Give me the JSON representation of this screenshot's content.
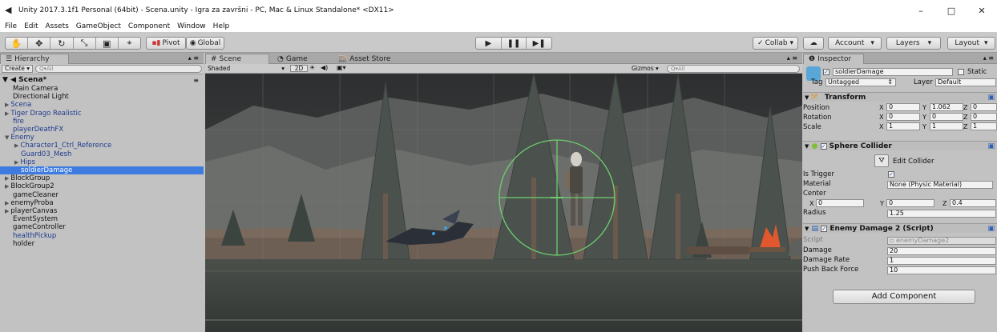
{
  "window": {
    "title": "Unity 2017.3.1f1 Personal (64bit) - Scena.unity - Igra za završni - PC, Mac & Linux Standalone* <DX11>",
    "controls": [
      "–",
      "□",
      "✕"
    ]
  },
  "menu": [
    "File",
    "Edit",
    "Assets",
    "GameObject",
    "Component",
    "Window",
    "Help"
  ],
  "toolbar": {
    "tool_icons": [
      "hand-icon",
      "move-icon",
      "rotate-icon",
      "scale-icon",
      "rect-icon",
      "transform-icon"
    ],
    "pivot": "Pivot",
    "global": "Global",
    "collab": "Collab ▾",
    "account": "Account",
    "layers": "Layers",
    "layout": "Layout"
  },
  "hierarchy": {
    "tab": "Hierarchy",
    "create": "Create ▾",
    "search_placeholder": "Q▾All",
    "scene": "Scena*",
    "items": [
      {
        "label": "Main Camera",
        "indent": 1,
        "blue": false,
        "arrow": false,
        "sel": false
      },
      {
        "label": "Directional Light",
        "indent": 1,
        "blue": false,
        "arrow": false,
        "sel": false
      },
      {
        "label": "Scena",
        "indent": 1,
        "blue": true,
        "arrow": true,
        "sel": false
      },
      {
        "label": "Tiger Drago Realistic",
        "indent": 1,
        "blue": true,
        "arrow": true,
        "sel": false
      },
      {
        "label": "fire",
        "indent": 1,
        "blue": true,
        "arrow": false,
        "sel": false
      },
      {
        "label": "playerDeathFX",
        "indent": 1,
        "blue": true,
        "arrow": false,
        "sel": false
      },
      {
        "label": "Enemy",
        "indent": 1,
        "blue": true,
        "arrow": true,
        "open": true,
        "sel": false
      },
      {
        "label": "Character1_Ctrl_Reference",
        "indent": 2,
        "blue": true,
        "arrow": true,
        "sel": false
      },
      {
        "label": "Guard03_Mesh",
        "indent": 2,
        "blue": true,
        "arrow": false,
        "sel": false
      },
      {
        "label": "Hips",
        "indent": 2,
        "blue": true,
        "arrow": true,
        "sel": false
      },
      {
        "label": "soldierDamage",
        "indent": 2,
        "blue": false,
        "arrow": false,
        "sel": true
      },
      {
        "label": "BlockGroup",
        "indent": 1,
        "blue": false,
        "arrow": true,
        "sel": false
      },
      {
        "label": "BlockGroup2",
        "indent": 1,
        "blue": false,
        "arrow": true,
        "sel": false
      },
      {
        "label": "gameCleaner",
        "indent": 1,
        "blue": false,
        "arrow": false,
        "sel": false
      },
      {
        "label": "enemyProba",
        "indent": 1,
        "blue": false,
        "arrow": true,
        "sel": false
      },
      {
        "label": "playerCanvas",
        "indent": 1,
        "blue": false,
        "arrow": true,
        "sel": false
      },
      {
        "label": "EventSystem",
        "indent": 1,
        "blue": false,
        "arrow": false,
        "sel": false
      },
      {
        "label": "gameController",
        "indent": 1,
        "blue": false,
        "arrow": false,
        "sel": false
      },
      {
        "label": "healthPickup",
        "indent": 1,
        "blue": true,
        "arrow": false,
        "sel": false
      },
      {
        "label": "holder",
        "indent": 1,
        "blue": false,
        "arrow": false,
        "sel": false
      }
    ]
  },
  "scene_view": {
    "tabs": [
      "Scene",
      "Game",
      "Asset Store"
    ],
    "shading": "Shaded",
    "mode_2d": "2D",
    "gizmos": "Gizmos ▾",
    "search_placeholder": "Q▾All"
  },
  "inspector": {
    "tab": "Inspector",
    "object_name": "soldierDamage",
    "static_label": "Static",
    "tag_label": "Tag",
    "tag_value": "Untagged",
    "layer_label": "Layer",
    "layer_value": "Default",
    "transform": {
      "title": "Transform",
      "rows": [
        {
          "label": "Position",
          "x": "0",
          "y": "1.062",
          "z": "0"
        },
        {
          "label": "Rotation",
          "x": "0",
          "y": "0",
          "z": "0"
        },
        {
          "label": "Scale",
          "x": "1",
          "y": "1",
          "z": "1"
        }
      ]
    },
    "sphere_collider": {
      "title": "Sphere Collider",
      "edit_collider": "Edit Collider",
      "is_trigger_label": "Is Trigger",
      "material_label": "Material",
      "material_value": "None (Physic Material)",
      "center_label": "Center",
      "center_x": "0",
      "center_y": "0",
      "center_z": "0.4",
      "radius_label": "Radius",
      "radius_value": "1.25"
    },
    "enemy_damage": {
      "title": "Enemy Damage 2 (Script)",
      "script_label": "Script",
      "script_value": "enemyDamage2",
      "damage_label": "Damage",
      "damage_value": "20",
      "rate_label": "Damage Rate",
      "rate_value": "1",
      "push_label": "Push Back Force",
      "push_value": "10"
    },
    "add_component": "Add Component"
  },
  "axis_letters": {
    "x": "X",
    "y": "Y",
    "z": "Z"
  }
}
